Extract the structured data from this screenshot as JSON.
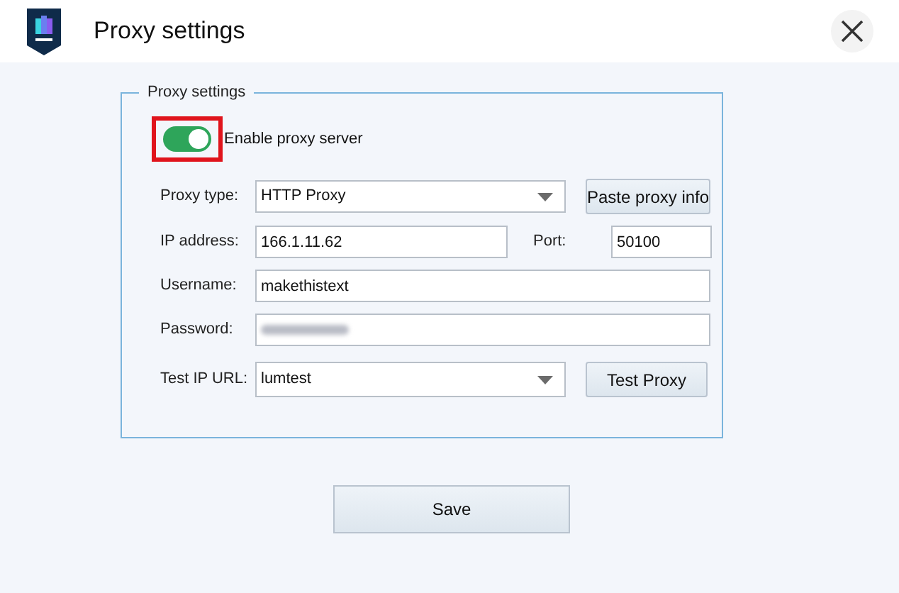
{
  "window": {
    "title": "Proxy settings"
  },
  "group": {
    "title": "Proxy settings"
  },
  "toggle": {
    "label": "Enable proxy server",
    "on": true,
    "highlighted": true
  },
  "proxy_type": {
    "label": "Proxy type:",
    "value": "HTTP Proxy",
    "button": "Paste proxy info"
  },
  "ip": {
    "label": "IP address:",
    "value": "166.1.11.62"
  },
  "port": {
    "label": "Port:",
    "value": "50100"
  },
  "username": {
    "label": "Username:",
    "value": "makethistext"
  },
  "password": {
    "label": "Password:"
  },
  "test_url": {
    "label": "Test IP URL:",
    "value": "lumtest",
    "button": "Test Proxy"
  },
  "save": "Save"
}
